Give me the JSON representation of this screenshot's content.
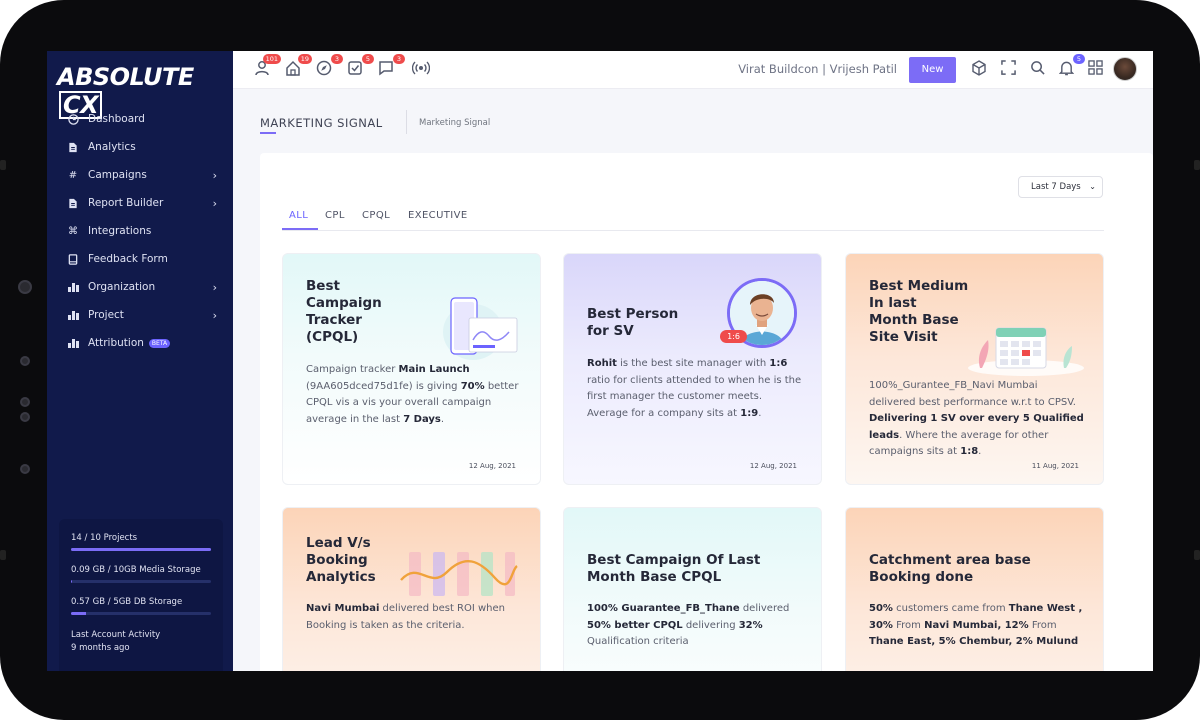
{
  "sidebar": {
    "logo_main": "ABSOLUTE",
    "logo_cx": "CX",
    "items": [
      {
        "label": "Dashboard",
        "icon": "clock-icon"
      },
      {
        "label": "Analytics",
        "icon": "document-icon"
      },
      {
        "label": "Campaigns",
        "icon": "hash-icon"
      },
      {
        "label": "Report Builder",
        "icon": "document-icon"
      },
      {
        "label": "Integrations",
        "icon": "command-icon"
      },
      {
        "label": "Feedback Form",
        "icon": "book-icon"
      },
      {
        "label": "Organization",
        "icon": "bar-chart-icon"
      },
      {
        "label": "Project",
        "icon": "bar-chart-icon"
      },
      {
        "label": "Attribution",
        "icon": "bar-chart-icon",
        "badge": "BETA"
      }
    ],
    "storage": {
      "projects": "14 / 10 Projects",
      "projects_fraction": 1.0,
      "media": "0.09 GB / 10GB Media Storage",
      "media_fraction": 0.01,
      "db": "0.57 GB / 5GB DB Storage",
      "db_fraction": 0.11,
      "activity_label": "Last Account Activity",
      "activity_value": "9 months ago"
    }
  },
  "topbar": {
    "badges": {
      "users": "101",
      "home": "19",
      "compass": "3",
      "tasks": "5",
      "messages": "3",
      "notifications": "5"
    },
    "company": "Virat Buildcon | Vrijesh Patil",
    "new_label": "New"
  },
  "page": {
    "title": "MARKETING SIGNAL",
    "breadcrumb": "Marketing Signal",
    "filter": "Last 7 Days",
    "tabs": [
      "ALL",
      "CPL",
      "CPQL",
      "EXECUTIVE"
    ]
  },
  "cards": {
    "c1": {
      "title": "Best Campaign Tracker (CPQL)",
      "p1": "Campaign tracker ",
      "b1": "Main Launch",
      "p2": " (9AA605dced75d1fe) is giving ",
      "b2": "70%",
      "p3": " better CPQL vis a vis your overall campaign average in the last ",
      "b3": "7 Days",
      "p4": ".",
      "date": "12 Aug, 2021"
    },
    "c2": {
      "title": "Best Person for SV",
      "ratio_pill": "1:6",
      "b1": "Rohit",
      "p1": " is the best site manager with ",
      "b2": "1:6",
      "p2": " ratio for clients attended to when he is the first manager the customer meets. Average for a company sits at ",
      "b3": "1:9",
      "p3": ".",
      "date": "12 Aug, 2021"
    },
    "c3": {
      "title": "Best Medium In last Month Base Site Visit",
      "p1": "100%_Gurantee_FB_Navi Mumbai delivered best performance w.r.t to CPSV. ",
      "b1": "Delivering 1 SV over every 5 Qualified leads",
      "p2": ". Where the average for other campaigns sits at ",
      "b2": "1:8",
      "p3": ".",
      "date": "11 Aug, 2021"
    },
    "c4": {
      "title": "Lead V/s Booking Analytics",
      "b1": "Navi Mumbai",
      "p1": " delivered best ROI when Booking is taken as the criteria."
    },
    "c5": {
      "title": "Best Campaign Of Last Month Base CPQL",
      "b1": "100% Guarantee_FB_Thane",
      "p1": " delivered ",
      "b2": "50% better CPQL",
      "p2": " delivering ",
      "b3": "32%",
      "p3": " Qualification criteria"
    },
    "c6": {
      "title": "Catchment area base Booking done",
      "b1": "50%",
      "p1": " customers came from ",
      "b2": "Thane West , 30%",
      "p2": " From ",
      "b3": "Navi Mumbai, 12%",
      "p3": " From ",
      "b4": "Thane East, 5% Chembur, 2% Mulund"
    }
  }
}
